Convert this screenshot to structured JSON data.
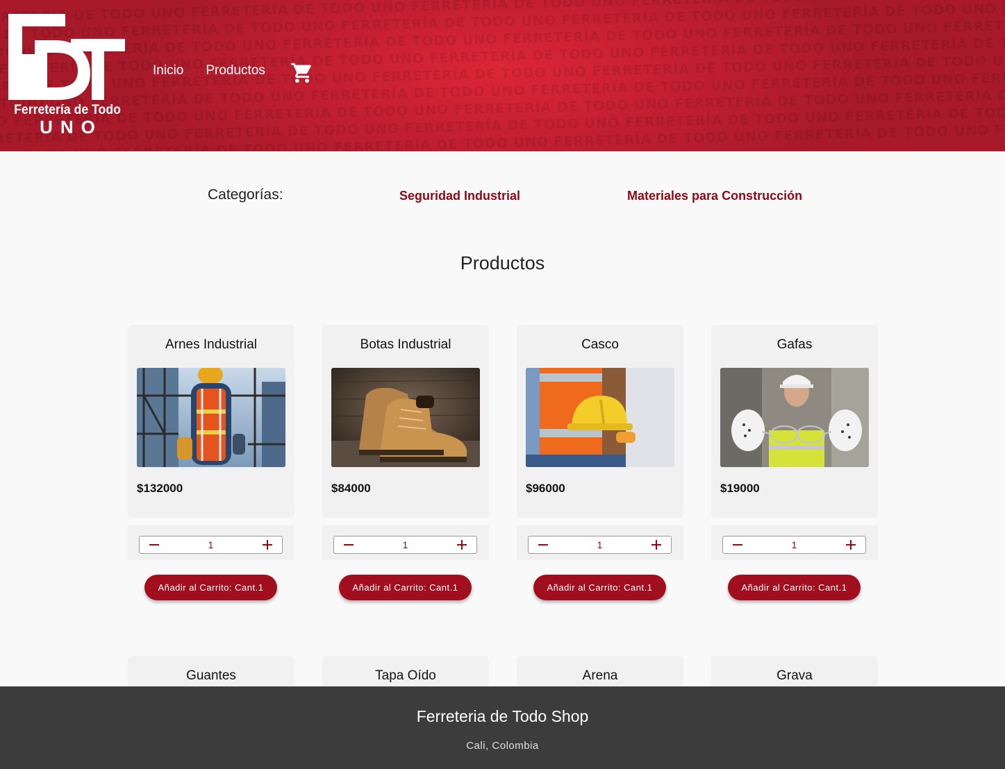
{
  "brand": {
    "logo_line1": "Ferretería de Todo",
    "logo_line2": "UNO",
    "pattern_text": "FERRETERÍA DE TODO UNO"
  },
  "nav": {
    "items": [
      {
        "label": "Inicio"
      },
      {
        "label": "Productos"
      }
    ],
    "cart_icon": "shopping-cart-icon"
  },
  "categories": {
    "label": "Categorías:",
    "items": [
      {
        "label": "Seguridad Industrial"
      },
      {
        "label": "Materiales para Construcción"
      }
    ]
  },
  "products_section": {
    "title": "Productos",
    "items": [
      {
        "name": "Arnes Industrial",
        "price": "$132000",
        "qty": "1",
        "button": "Añadir al Carrito: Cant.1"
      },
      {
        "name": "Botas Industrial",
        "price": "$84000",
        "qty": "1",
        "button": "Añadir al Carrito: Cant.1"
      },
      {
        "name": "Casco",
        "price": "$96000",
        "qty": "1",
        "button": "Añadir al Carrito: Cant.1"
      },
      {
        "name": "Gafas",
        "price": "$19000",
        "qty": "1",
        "button": "Añadir al Carrito: Cant.1"
      }
    ],
    "next_row": [
      {
        "name": "Guantes"
      },
      {
        "name": "Tapa Oído"
      },
      {
        "name": "Arena"
      },
      {
        "name": "Grava"
      }
    ]
  },
  "footer": {
    "title": "Ferreteria de Todo Shop",
    "location": "Cali, Colombia"
  },
  "colors": {
    "brand_red": "#a10f1f",
    "header_red": "#c01f31",
    "link_red": "#8b0a16",
    "footer_bg": "#3c3c3c",
    "page_bg": "#f9f9f9"
  }
}
